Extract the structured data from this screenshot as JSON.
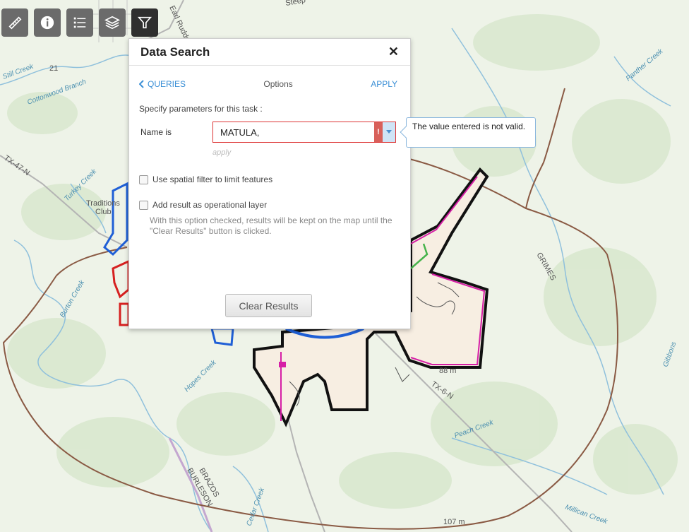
{
  "toolbar": {
    "tools": [
      {
        "icon": "ruler-icon",
        "label": ""
      },
      {
        "icon": "info-icon",
        "label": ""
      },
      {
        "icon": "list-icon",
        "label": ""
      },
      {
        "icon": "layers-icon",
        "label": ""
      },
      {
        "icon": "filter-icon",
        "label": ""
      }
    ],
    "active_tool": "filter-icon",
    "button_color": "#6b6b6b",
    "active_color": "#2f2f2f"
  },
  "panel": {
    "title": "Data Search",
    "close_glyph": "✕",
    "back_label": "QUERIES",
    "options_label": "Options",
    "apply_label": "APPLY",
    "specify_text": "Specify parameters for this task :",
    "name_label": "Name is",
    "name_value": "MATULA,",
    "error_glyph": "!",
    "apply_hint": "apply",
    "spatial_filter_label": "Use spatial filter to limit features",
    "spatial_filter_checked": false,
    "operational_layer_label": "Add result as operational layer",
    "operational_layer_checked": false,
    "help_text": "With this option checked, results will be kept on the map until the \"Clear Results\" button is clicked.",
    "clear_results_label": "Clear Results"
  },
  "tooltip": {
    "text": "The value entered is not valid."
  },
  "map": {
    "labels": {
      "still_creek": "Still Creek",
      "cottonwood": "Cottonwood Branch",
      "turkey_creek": "Turkey Creek",
      "traditions": "Traditions",
      "club": "Club",
      "burton_creek": "Burton Creek",
      "hopes_creek": "Hopes Creek",
      "grimes": "GRIMES",
      "panther_creek": "Panther Creek",
      "tx47": "TX-47-N",
      "tx6": "TX-6-N",
      "brazos": "BRAZOS",
      "burleson": "BURLESON",
      "peach_creek": "Peach Creek",
      "millican_creek": "Millican Creek",
      "cedar_creek": "Cedar Creek",
      "gibbons": "Gibbons",
      "earl_rudder": "Earl Rudder",
      "steep": "Steep",
      "elev_88": "88 m",
      "elev_107": "107 m",
      "road_21": "21"
    },
    "colors": {
      "buffer": "#8a5a44",
      "boundary": "#111111",
      "highlight": "#d61fa6",
      "blue_parcel": "#1f5fd6",
      "red_parcel": "#d62020",
      "green_line": "#46b34b",
      "city_fill": "#f7eee2",
      "water": "#6aa7c9"
    }
  }
}
